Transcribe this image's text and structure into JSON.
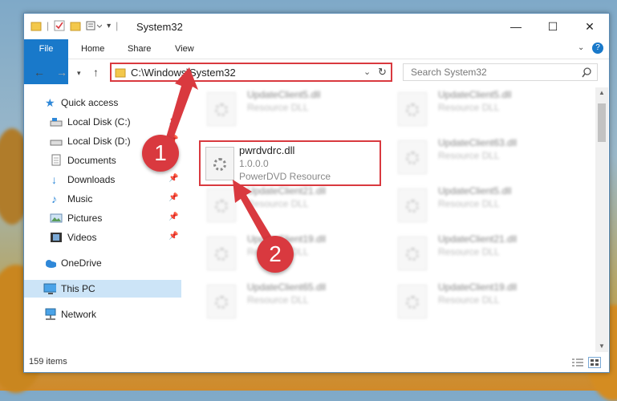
{
  "window": {
    "title": "System32",
    "controls": {
      "minimize": "—",
      "maximize": "☐",
      "close": "✕"
    }
  },
  "ribbon": {
    "tabs": [
      "File",
      "Home",
      "Share",
      "View"
    ],
    "help_icon": "?"
  },
  "address_bar": {
    "path": "C:\\Windows\\System32",
    "search_placeholder": "Search System32"
  },
  "sidebar": {
    "items": [
      {
        "label": "Quick access",
        "icon": "star-icon"
      },
      {
        "label": "Local Disk (C:)",
        "icon": "drive-icon"
      },
      {
        "label": "Local Disk (D:)",
        "icon": "drive-icon"
      },
      {
        "label": "Documents",
        "icon": "documents-icon"
      },
      {
        "label": "Downloads",
        "icon": "download-icon"
      },
      {
        "label": "Music",
        "icon": "music-icon"
      },
      {
        "label": "Pictures",
        "icon": "pictures-icon"
      },
      {
        "label": "Videos",
        "icon": "videos-icon"
      },
      {
        "label": "OneDrive",
        "icon": "cloud-icon"
      },
      {
        "label": "This PC",
        "icon": "computer-icon"
      },
      {
        "label": "Network",
        "icon": "network-icon"
      }
    ]
  },
  "files": {
    "selected": {
      "name": "pwrdvdrc.dll",
      "version": "1.0.0.0",
      "description": "PowerDVD Resource"
    },
    "left_column": [
      {
        "name": "UpdateClient5.dll",
        "description": "Resource DLL"
      },
      {
        "name": "UpdateClient21.dll",
        "description": "Resource DLL"
      },
      {
        "name": "UpdateClient19.dll",
        "description": "Resource DLL"
      },
      {
        "name": "UpdateClient65.dll",
        "description": "Resource DLL"
      }
    ],
    "right_column": [
      {
        "name": "UpdateClient5.dll",
        "description": "Resource DLL"
      },
      {
        "name": "UpdateClient63.dll",
        "description": "Resource DLL"
      },
      {
        "name": "UpdateClient5.dll",
        "description": "Resource DLL"
      },
      {
        "name": "UpdateClient21.dll",
        "description": "Resource DLL"
      },
      {
        "name": "UpdateClient19.dll",
        "description": "Resource DLL"
      }
    ]
  },
  "status": {
    "item_count": "159 items"
  },
  "annotations": {
    "step1": "1",
    "step2": "2",
    "color": "#d9393f"
  }
}
